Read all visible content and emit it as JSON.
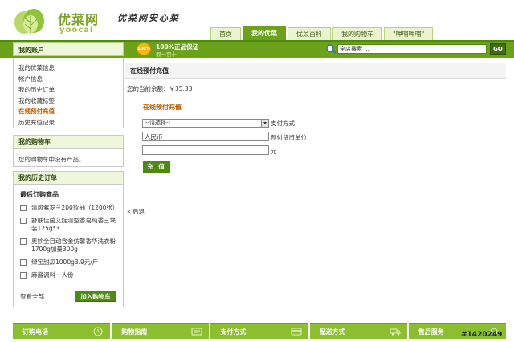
{
  "header": {
    "logo_cn": "优菜网",
    "logo_en": "yoocai",
    "slogan": "优菜网安心菜",
    "nav": [
      "首页",
      "我的优菜",
      "优菜百科",
      "我的购物车",
      "\"呷哺呷哺\""
    ],
    "active_tab_index": 1
  },
  "topbar": {
    "badge": "100%",
    "promise_main": "100%正品保证",
    "promise_sub": "假一罚十",
    "search_value": "全店搜索 ...",
    "go_label": "GO"
  },
  "sidebar": {
    "account": {
      "title": "我的账户",
      "items": [
        "我的优菜信息",
        "帐户信息",
        "我的历史订单",
        "我的收藏标签",
        "在线预付充值",
        "历史充值记录"
      ],
      "current_index": 4
    },
    "cart": {
      "title": "我的购物车",
      "message": "您的购物车中没有产品。"
    },
    "history": {
      "title": "我的历史订单",
      "subtitle": "最后订购商品",
      "products": [
        "清风紫罗兰200软抽（1200张）",
        "舒肤佳茵艾绽清型香皂纯香三块装125g*3",
        "奥妙全自动含金纺馨香华洗衣粉1700g加量300g",
        "绿宝甜瓜1000g3.9元/斤",
        "麻酱调料一人份"
      ],
      "view_all": "查看全部",
      "add_to_cart": "加入购物车"
    }
  },
  "main": {
    "title": "在线预付充值",
    "balance": "您的当前余额：￥35.33",
    "form_title": "在线预付充值",
    "payment_select": "--请选择--",
    "payment_label": "支付方式",
    "currency_value": "人民币",
    "currency_label": "预付货币单位",
    "amount_value": "",
    "amount_unit": "元",
    "submit_label": "充 值",
    "back_link": "« 后退"
  },
  "footer": {
    "items": [
      {
        "label": "订购电话",
        "icon": "clock-icon"
      },
      {
        "label": "购物指南",
        "icon": "guide-icon"
      },
      {
        "label": "支付方式",
        "icon": "card-icon"
      },
      {
        "label": "配送方式",
        "icon": "truck-icon"
      },
      {
        "label": "售后服务",
        "icon": "service-icon"
      }
    ]
  },
  "watermark": "#1420249",
  "colors": {
    "brand_green": "#6aa31a",
    "light_green": "#eef6dc",
    "accent_orange": "#c25b00"
  }
}
